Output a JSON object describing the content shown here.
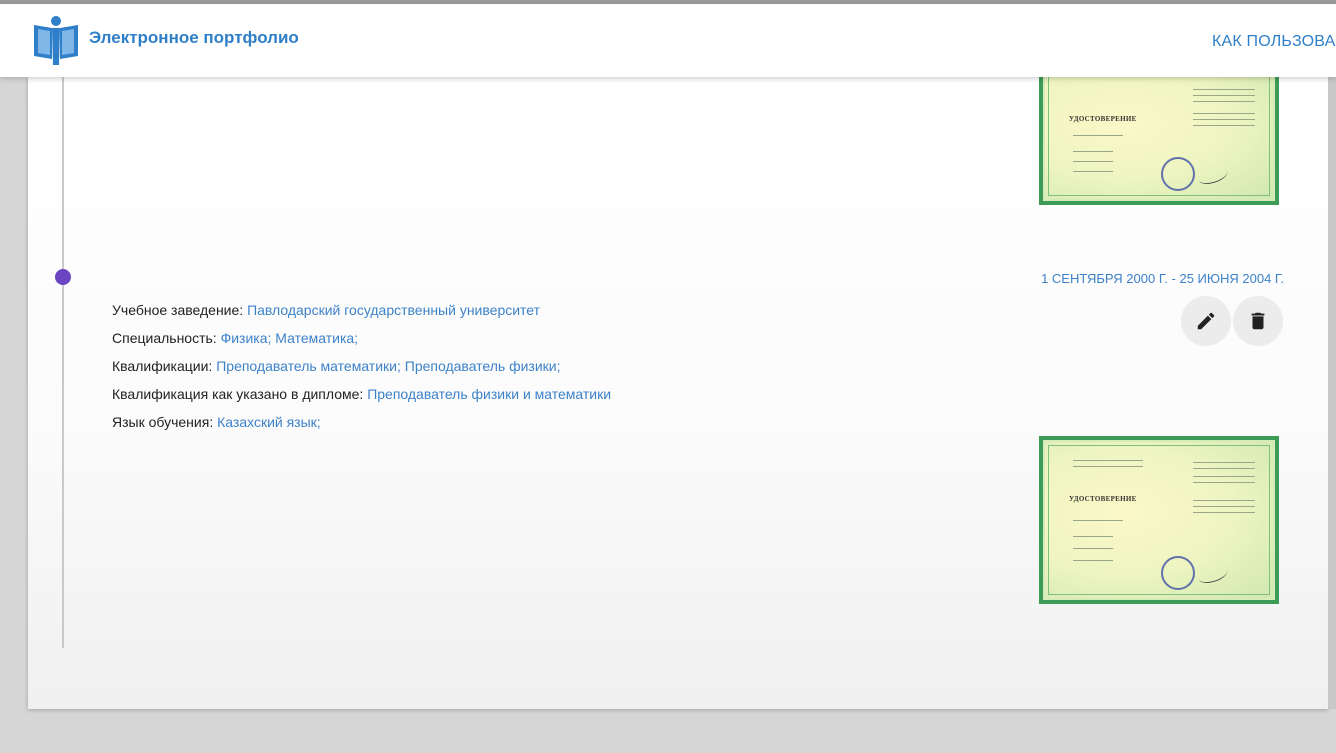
{
  "header": {
    "brand_name": "Электронное портфолио",
    "nav_howto": "КАК ПОЛЬЗОВА"
  },
  "colors": {
    "accent": "#2f7fc8",
    "link": "#3d82c9",
    "timeline_dot": "#6a45c2",
    "certificate_border": "#3c9b56"
  },
  "icons": {
    "logo": "book-person-logo-icon",
    "edit": "pencil-icon",
    "delete": "trash-icon"
  },
  "education_entry": {
    "dates": "1 СЕНТЯБРЯ 2000 Г. - 25 ИЮНЯ 2004 Г.",
    "fields": [
      {
        "label": "Учебное заведение: ",
        "value": "Павлодарский государственный университет"
      },
      {
        "label": "Специальность: ",
        "value": "Физика; Математика;"
      },
      {
        "label": "Квалификации: ",
        "value": "Преподаватель математики; Преподаватель физики;"
      },
      {
        "label": "Квалификация как указано в дипломе: ",
        "value": "Преподаватель физики и математики"
      },
      {
        "label": "Язык обучения: ",
        "value": "Казахский язык;"
      }
    ]
  },
  "certificate": {
    "heading": "УДОСТОВЕРЕНИЕ"
  }
}
